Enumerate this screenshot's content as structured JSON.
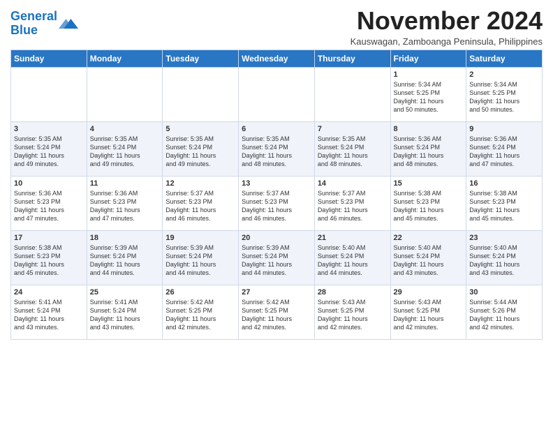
{
  "logo": {
    "line1": "General",
    "line2": "Blue"
  },
  "title": "November 2024",
  "subtitle": "Kauswagan, Zamboanga Peninsula, Philippines",
  "headers": [
    "Sunday",
    "Monday",
    "Tuesday",
    "Wednesday",
    "Thursday",
    "Friday",
    "Saturday"
  ],
  "weeks": [
    [
      {
        "day": "",
        "info": ""
      },
      {
        "day": "",
        "info": ""
      },
      {
        "day": "",
        "info": ""
      },
      {
        "day": "",
        "info": ""
      },
      {
        "day": "",
        "info": ""
      },
      {
        "day": "1",
        "info": "Sunrise: 5:34 AM\nSunset: 5:25 PM\nDaylight: 11 hours\nand 50 minutes."
      },
      {
        "day": "2",
        "info": "Sunrise: 5:34 AM\nSunset: 5:25 PM\nDaylight: 11 hours\nand 50 minutes."
      }
    ],
    [
      {
        "day": "3",
        "info": "Sunrise: 5:35 AM\nSunset: 5:24 PM\nDaylight: 11 hours\nand 49 minutes."
      },
      {
        "day": "4",
        "info": "Sunrise: 5:35 AM\nSunset: 5:24 PM\nDaylight: 11 hours\nand 49 minutes."
      },
      {
        "day": "5",
        "info": "Sunrise: 5:35 AM\nSunset: 5:24 PM\nDaylight: 11 hours\nand 49 minutes."
      },
      {
        "day": "6",
        "info": "Sunrise: 5:35 AM\nSunset: 5:24 PM\nDaylight: 11 hours\nand 48 minutes."
      },
      {
        "day": "7",
        "info": "Sunrise: 5:35 AM\nSunset: 5:24 PM\nDaylight: 11 hours\nand 48 minutes."
      },
      {
        "day": "8",
        "info": "Sunrise: 5:36 AM\nSunset: 5:24 PM\nDaylight: 11 hours\nand 48 minutes."
      },
      {
        "day": "9",
        "info": "Sunrise: 5:36 AM\nSunset: 5:24 PM\nDaylight: 11 hours\nand 47 minutes."
      }
    ],
    [
      {
        "day": "10",
        "info": "Sunrise: 5:36 AM\nSunset: 5:23 PM\nDaylight: 11 hours\nand 47 minutes."
      },
      {
        "day": "11",
        "info": "Sunrise: 5:36 AM\nSunset: 5:23 PM\nDaylight: 11 hours\nand 47 minutes."
      },
      {
        "day": "12",
        "info": "Sunrise: 5:37 AM\nSunset: 5:23 PM\nDaylight: 11 hours\nand 46 minutes."
      },
      {
        "day": "13",
        "info": "Sunrise: 5:37 AM\nSunset: 5:23 PM\nDaylight: 11 hours\nand 46 minutes."
      },
      {
        "day": "14",
        "info": "Sunrise: 5:37 AM\nSunset: 5:23 PM\nDaylight: 11 hours\nand 46 minutes."
      },
      {
        "day": "15",
        "info": "Sunrise: 5:38 AM\nSunset: 5:23 PM\nDaylight: 11 hours\nand 45 minutes."
      },
      {
        "day": "16",
        "info": "Sunrise: 5:38 AM\nSunset: 5:23 PM\nDaylight: 11 hours\nand 45 minutes."
      }
    ],
    [
      {
        "day": "17",
        "info": "Sunrise: 5:38 AM\nSunset: 5:23 PM\nDaylight: 11 hours\nand 45 minutes."
      },
      {
        "day": "18",
        "info": "Sunrise: 5:39 AM\nSunset: 5:24 PM\nDaylight: 11 hours\nand 44 minutes."
      },
      {
        "day": "19",
        "info": "Sunrise: 5:39 AM\nSunset: 5:24 PM\nDaylight: 11 hours\nand 44 minutes."
      },
      {
        "day": "20",
        "info": "Sunrise: 5:39 AM\nSunset: 5:24 PM\nDaylight: 11 hours\nand 44 minutes."
      },
      {
        "day": "21",
        "info": "Sunrise: 5:40 AM\nSunset: 5:24 PM\nDaylight: 11 hours\nand 44 minutes."
      },
      {
        "day": "22",
        "info": "Sunrise: 5:40 AM\nSunset: 5:24 PM\nDaylight: 11 hours\nand 43 minutes."
      },
      {
        "day": "23",
        "info": "Sunrise: 5:40 AM\nSunset: 5:24 PM\nDaylight: 11 hours\nand 43 minutes."
      }
    ],
    [
      {
        "day": "24",
        "info": "Sunrise: 5:41 AM\nSunset: 5:24 PM\nDaylight: 11 hours\nand 43 minutes."
      },
      {
        "day": "25",
        "info": "Sunrise: 5:41 AM\nSunset: 5:24 PM\nDaylight: 11 hours\nand 43 minutes."
      },
      {
        "day": "26",
        "info": "Sunrise: 5:42 AM\nSunset: 5:25 PM\nDaylight: 11 hours\nand 42 minutes."
      },
      {
        "day": "27",
        "info": "Sunrise: 5:42 AM\nSunset: 5:25 PM\nDaylight: 11 hours\nand 42 minutes."
      },
      {
        "day": "28",
        "info": "Sunrise: 5:43 AM\nSunset: 5:25 PM\nDaylight: 11 hours\nand 42 minutes."
      },
      {
        "day": "29",
        "info": "Sunrise: 5:43 AM\nSunset: 5:25 PM\nDaylight: 11 hours\nand 42 minutes."
      },
      {
        "day": "30",
        "info": "Sunrise: 5:44 AM\nSunset: 5:26 PM\nDaylight: 11 hours\nand 42 minutes."
      }
    ]
  ]
}
